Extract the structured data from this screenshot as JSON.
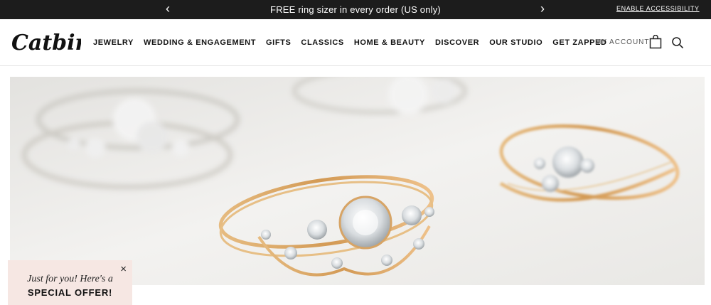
{
  "announcement": {
    "message": "FREE ring sizer in every order (US only)",
    "prev_arrow": "‹",
    "next_arrow": "›",
    "accessibility_link": "ENABLE ACCESSIBILITY"
  },
  "header": {
    "logo_text": "Catbird",
    "nav": [
      "JEWELRY",
      "WEDDING & ENGAGEMENT",
      "GIFTS",
      "CLASSICS",
      "HOME & BEAUTY",
      "DISCOVER",
      "OUR STUDIO",
      "GET ZAPPED"
    ],
    "account_label": "MY ACCOUNT",
    "icons": [
      "shopping-bag-icon",
      "search-icon"
    ]
  },
  "hero": {
    "image_subject": "gold and silver diamond rings on white surface"
  },
  "offer_popup": {
    "line1": "Just for you! Here's a",
    "line2": "SPECIAL OFFER!",
    "close": "×"
  },
  "colors": {
    "announcement_bg": "#1c1c1c",
    "offer_bg": "#f6e7e3",
    "gold": "#d8a86a"
  }
}
